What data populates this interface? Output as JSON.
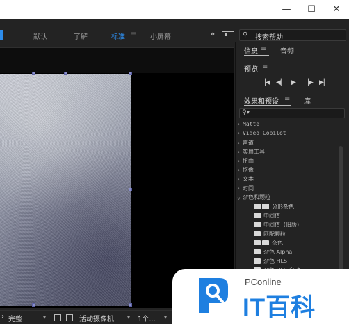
{
  "window": {
    "min_glyph": "—",
    "max_glyph": "☐",
    "close_glyph": "✕"
  },
  "workspace": {
    "tabs": [
      "默认",
      "了解",
      "标准",
      "小屏幕"
    ],
    "active_tab": "标准",
    "menu_glyph": "≡",
    "overflow_glyph": "»",
    "search_placeholder": "搜索帮助"
  },
  "comp_footer": {
    "resolution": "完整",
    "camera": "活动摄像机",
    "views": "1个..."
  },
  "panels": {
    "info": {
      "tab1": "信息",
      "tab2": "音频"
    },
    "preview": {
      "title": "预览"
    },
    "effects": {
      "tab1": "效果和预设",
      "tab2": "库",
      "search_icon": "🔍"
    }
  },
  "effects_list": [
    {
      "label": "Matte",
      "expanded": false
    },
    {
      "label": "Video Copilot",
      "expanded": false
    },
    {
      "label": "声道",
      "expanded": false
    },
    {
      "label": "实用工具",
      "expanded": false
    },
    {
      "label": "扭曲",
      "expanded": false
    },
    {
      "label": "抠像",
      "expanded": false
    },
    {
      "label": "文本",
      "expanded": false
    },
    {
      "label": "时间",
      "expanded": false
    },
    {
      "label": "杂色和颗粒",
      "expanded": true
    }
  ],
  "effects_sub": [
    {
      "label": "分形杂色",
      "icon": "double"
    },
    {
      "label": "中间值",
      "icon": "single"
    },
    {
      "label": "中间值（旧版）",
      "icon": "single"
    },
    {
      "label": "匹配颗粒",
      "icon": "single"
    },
    {
      "label": "杂色",
      "icon": "double"
    },
    {
      "label": "杂色 Alpha",
      "icon": "single"
    },
    {
      "label": "杂色 HLS",
      "icon": "single"
    },
    {
      "label": "杂色 HLS 自动",
      "icon": "single"
    }
  ],
  "watermark": {
    "small": "PConline",
    "big": "IT百科"
  },
  "colors": {
    "accent": "#2d8ceb",
    "panel": "#232323",
    "watermark_blue": "#1e7fe0"
  }
}
